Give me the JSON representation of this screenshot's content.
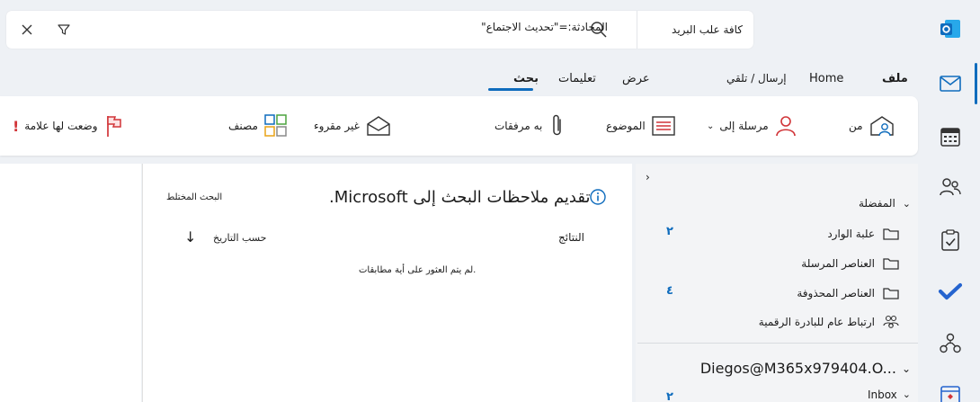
{
  "search": {
    "scope": "كافة علب البريد",
    "query": "المحادثة:=\"تحديث الاجتماع\""
  },
  "tabs": [
    {
      "label": "ملف"
    },
    {
      "label": "Home"
    },
    {
      "label": "إرسال / تلقي"
    },
    {
      "label": "عرض"
    },
    {
      "label": "تعليمات"
    },
    {
      "label": "بحث"
    }
  ],
  "ribbon": {
    "from": "من",
    "sent_to": "مرسلة إلى",
    "subject": "الموضوع",
    "has_attachments": "به مرفقات",
    "unread": "غير مقروء",
    "categorized": "مصنف",
    "flagged": "وضعت لها علامة"
  },
  "folders": {
    "favorites_label": "المفضلة",
    "items": [
      {
        "name": "علبة الوارد",
        "count": "٢"
      },
      {
        "name": "العناصر المرسلة",
        "count": ""
      },
      {
        "name": "العناصر المحذوفة",
        "count": "٤"
      },
      {
        "name": "ارتباط عام للبادرة الرقمية",
        "count": ""
      }
    ],
    "account": "Diegos@M365x979404.O...",
    "inbox_partial": "Inbox",
    "inbox_partial_count": "٢"
  },
  "message_list": {
    "feedback": "تقديم ملاحظات البحث إلى Microsoft.",
    "search_type": "البحث المختلط",
    "results_label": "النتائج",
    "sort_by": "حسب التاريخ",
    "empty_text": "لم يتم العثور على أية مطابقات."
  },
  "colors": {
    "accent": "#0f6cbd",
    "flag_red": "#d13438",
    "outlook_blue": "#0f6cbd"
  }
}
